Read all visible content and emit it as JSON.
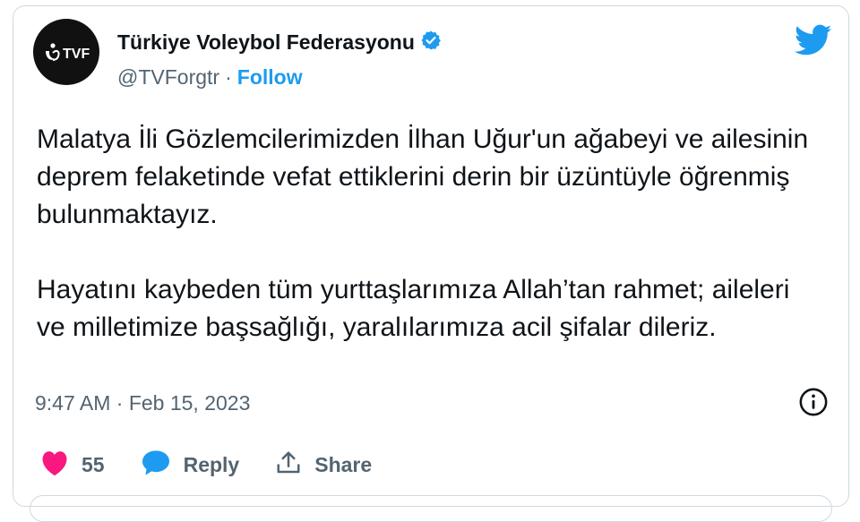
{
  "account": {
    "display_name": "Türkiye Voleybol Federasyonu",
    "handle": "@TVForgtr",
    "separator": "·",
    "follow_label": "Follow",
    "avatar_text": "TVF",
    "verified_icon": "verified-badge-icon"
  },
  "tweet": {
    "paragraph_1": "Malatya İli Gözlemcilerimizden İlhan Uğur'un ağabeyi ve ailesinin deprem felaketinde vefat ettiklerini derin bir üzüntüyle öğrenmiş bulunmaktayız.",
    "paragraph_2": "Hayatını kaybeden tüm yurttaşlarımıza Allah’tan rahmet; aileleri ve milletimize başsağlığı, yaralılarımıza acil şifalar dileriz.",
    "timestamp": "9:47 AM · Feb 15, 2023"
  },
  "actions": {
    "like_count": "55",
    "reply_label": "Reply",
    "share_label": "Share"
  },
  "colors": {
    "brand_blue": "#1d9bf0",
    "like_pink": "#f91880",
    "muted": "#536471",
    "border": "#cfd9de"
  }
}
